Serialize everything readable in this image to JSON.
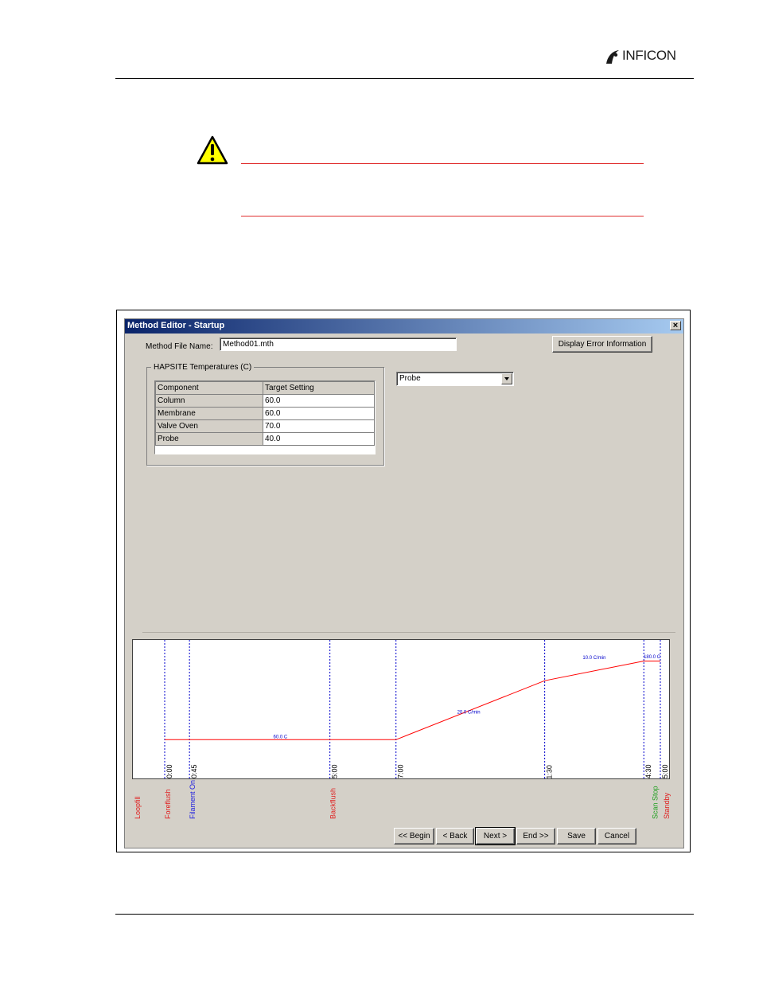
{
  "page": {
    "logo_text": "INFICON"
  },
  "window": {
    "title": "Method Editor - Startup",
    "close_glyph": "×",
    "file_name_label": "Method File Name:",
    "file_name_value": "Method01.mth",
    "display_error_button": "Display Error Information",
    "group_title": "HAPSITE Temperatures (C)",
    "table": {
      "headers": [
        "Component",
        "Target Setting"
      ],
      "rows": [
        [
          "Column",
          "60.0"
        ],
        [
          "Membrane",
          "60.0"
        ],
        [
          "Valve Oven",
          "70.0"
        ],
        [
          "Probe",
          "40.0"
        ]
      ]
    },
    "dropdown_value": "Probe",
    "nav_buttons": [
      "<< Begin",
      "< Back",
      "Next >",
      "End >>",
      "Save",
      "Cancel"
    ]
  },
  "timeline": {
    "times": [
      "00:00",
      "00:45",
      "05:00",
      "07:00",
      "11:30",
      "14:30",
      "15:00"
    ],
    "time_values_min": [
      0,
      0.75,
      5,
      7,
      11.5,
      14.5,
      15
    ],
    "start_min": -1,
    "end_min": 15.3,
    "profile_points": [
      [
        0,
        60
      ],
      [
        7,
        60
      ],
      [
        11.5,
        150
      ],
      [
        14.5,
        180
      ],
      [
        15,
        180
      ]
    ],
    "temp_axis": [
      30,
      200
    ],
    "segment_labels": [
      "60.0 C",
      "20.0 C/min",
      "10.0 C/min",
      "180.0 C"
    ],
    "segment_label_times": [
      3.5,
      9.2,
      13.0,
      14.75
    ],
    "segment_label_temps": [
      62,
      100,
      183,
      184
    ],
    "events": [
      {
        "label": "Loopfill",
        "time": -1,
        "color": "#e02020"
      },
      {
        "label": "Foreflush",
        "time": 0,
        "color": "#e02020"
      },
      {
        "label": "Filament On",
        "time": 0.75,
        "color": "#2020e0"
      },
      {
        "label": "Backflush",
        "time": 5,
        "color": "#e02020"
      },
      {
        "label": "Scan Stop",
        "time": 14.75,
        "color": "#20a020"
      },
      {
        "label": "Standby",
        "time": 15.1,
        "color": "#e02020"
      }
    ],
    "colors": {
      "profile": "#ff0000",
      "marker": "#0000cc",
      "segment_text": "#0000cc"
    }
  }
}
